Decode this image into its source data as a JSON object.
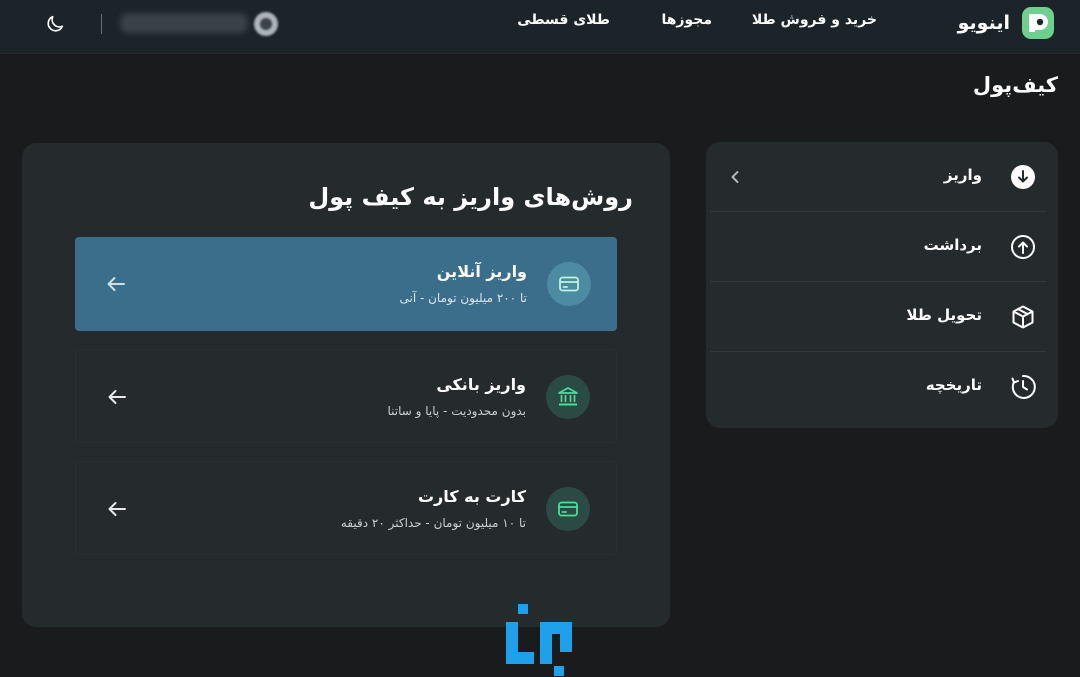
{
  "header": {
    "brand_name": "اینویو",
    "nav": {
      "buy_sell_gold": "خرید و فروش طلا",
      "licenses": "مجوزها",
      "installment_gold": "طلای قسطی"
    },
    "icons": [
      "brand-logo",
      "moon-icon",
      "user-icon"
    ]
  },
  "page_title": "کیف‌پول",
  "menu": {
    "items": [
      {
        "label": "واریز",
        "icon": "download-circle-icon",
        "selected": true
      },
      {
        "label": "برداشت",
        "icon": "upload-circle-icon"
      },
      {
        "label": "تحویل طلا",
        "icon": "box-icon"
      },
      {
        "label": "تاریخچه",
        "icon": "history-icon"
      }
    ]
  },
  "main": {
    "title": "روش‌های واریز به کیف پول",
    "methods": [
      {
        "title": "واریز آنلاین",
        "subtitle": "تا ۲۰۰ میلیون تومان - آنی",
        "icon": "card-icon",
        "active": true
      },
      {
        "title": "واریز بانکی",
        "subtitle": "بدون محدودیت - پایا و ساتنا",
        "icon": "bank-icon",
        "active": false
      },
      {
        "title": "کارت به کارت",
        "subtitle": "تا ۱۰ میلیون تومان - حداکثر ۲۰ دقیقه",
        "icon": "card-icon",
        "active": false
      }
    ]
  },
  "colors": {
    "background": "#1a1b1d",
    "card": "#252a2d",
    "active_method": "#3a6e8a",
    "accent_green": "#4ade9b",
    "watermark_blue": "#1ea0ea"
  }
}
